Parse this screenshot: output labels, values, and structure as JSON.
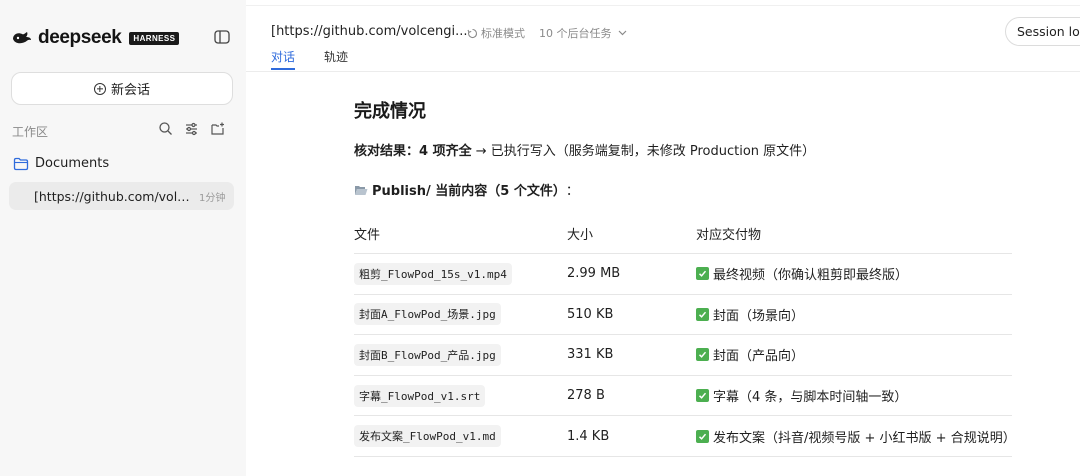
{
  "sidebar": {
    "brand": "deepseek",
    "badge": "HARNESS",
    "new_chat_label": "新会话",
    "workspace_label": "工作区",
    "folder_name": "Documents",
    "session": {
      "title": "[https://github.com/volcengine/",
      "time": "1分钟"
    }
  },
  "header": {
    "title": "[https://github.com/volcengi...",
    "mode": "标准模式",
    "bg_tasks": "10 个后台任务",
    "tabs": [
      "对话",
      "轨迹"
    ],
    "session_log": "Session log"
  },
  "main": {
    "heading": "完成情况",
    "summary_bold": "核对结果：4 项齐全",
    "summary_rest": " → 已执行写入（服务端复制，未修改 Production 原文件）",
    "folder_bold": "Publish/ 当前内容（5 个文件）",
    "folder_suffix": "：",
    "table": {
      "headers": [
        "文件",
        "大小",
        "对应交付物"
      ],
      "rows": [
        {
          "file": "粗剪_FlowPod_15s_v1.mp4",
          "size": "2.99 MB",
          "deliverable": "最终视频（你确认粗剪即最终版）"
        },
        {
          "file": "封面A_FlowPod_场景.jpg",
          "size": "510 KB",
          "deliverable": "封面（场景向）"
        },
        {
          "file": "封面B_FlowPod_产品.jpg",
          "size": "331 KB",
          "deliverable": "封面（产品向）"
        },
        {
          "file": "字幕_FlowPod_v1.srt",
          "size": "278 B",
          "deliverable": "字幕（4 条，与脚本时间轴一致）"
        },
        {
          "file": "发布文案_FlowPod_v1.md",
          "size": "1.4 KB",
          "deliverable": "发布文案（抖音/视频号版 + 小红书版 + 合规说明）"
        }
      ]
    }
  },
  "colors": {
    "accent": "#2f6bdc",
    "check": "#4caf50",
    "sidebar_bg": "#f7f7f7"
  }
}
